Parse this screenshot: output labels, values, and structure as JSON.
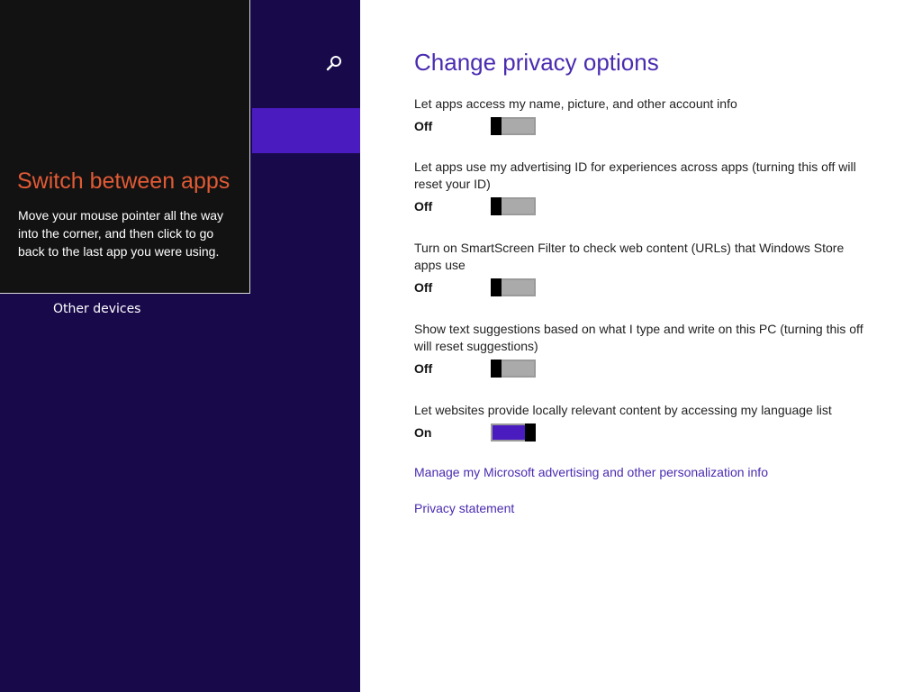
{
  "colors": {
    "nav_background": "#180a4a",
    "nav_selected": "#4a1cc0",
    "accent": "#4a2bb0",
    "tip_title": "#e05a35"
  },
  "nav": {
    "search_icon": "magnifier-icon",
    "items": [
      {
        "label": "Other devices"
      }
    ]
  },
  "tip": {
    "title": "Switch between apps",
    "body": "Move your mouse pointer all the way into the corner, and then click to go back to the last app you were using."
  },
  "page": {
    "title": "Change privacy options",
    "settings": [
      {
        "description": "Let apps access my name, picture, and other account info",
        "state": "Off"
      },
      {
        "description": "Let apps use my advertising ID for experiences across apps (turning this off will reset your ID)",
        "state": "Off"
      },
      {
        "description": "Turn on SmartScreen Filter to check web content (URLs) that Windows Store apps use",
        "state": "Off"
      },
      {
        "description": "Show text suggestions based on what I type and write on this PC (turning this off will reset suggestions)",
        "state": "Off"
      },
      {
        "description": "Let websites provide locally relevant content by accessing my language list",
        "state": "On"
      }
    ],
    "links": [
      {
        "label": "Manage my Microsoft advertising and other personalization info"
      },
      {
        "label": "Privacy statement"
      }
    ]
  }
}
